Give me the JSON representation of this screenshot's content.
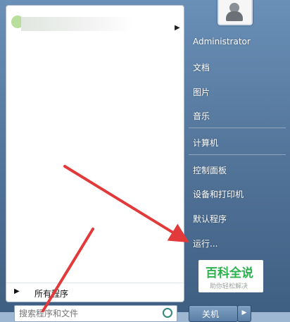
{
  "user": {
    "name": "Administrator"
  },
  "right_menu": {
    "documents": "文档",
    "pictures": "图片",
    "music": "音乐",
    "computer": "计算机",
    "control_panel": "控制面板",
    "devices_printers": "设备和打印机",
    "default_programs": "默认程序",
    "run": "运行..."
  },
  "left_panel": {
    "all_programs": "所有程序",
    "search_placeholder": "搜索程序和文件"
  },
  "shutdown": {
    "label": "关机"
  },
  "watermark": {
    "title": "百科全说",
    "subtitle": "助你轻松解决"
  },
  "icons": [
    "user-avatar-icon",
    "search-icon",
    "pin-arrow-icon",
    "all-programs-arrow-icon",
    "shutdown-options-icon"
  ],
  "colors": {
    "arrow": "#e23a3a",
    "watermark_green": "#2bb24c"
  }
}
